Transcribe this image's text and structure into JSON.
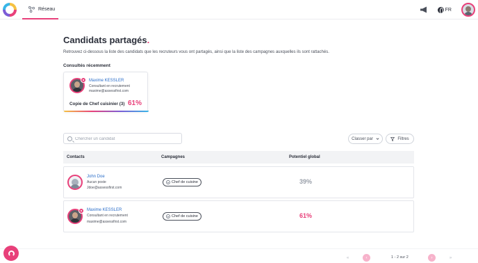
{
  "nav": {
    "tab_label": "Réseau"
  },
  "header": {
    "lang_label": "FR"
  },
  "page": {
    "title": "Candidats partagés",
    "title_dot": ".",
    "description": "Retrouvez ci-dessous la liste des candidats que les recruteurs vous ont partagés, ainsi que la liste des campagnes auxquelles ils sont rattachés."
  },
  "recent": {
    "title": "Consultés récemment",
    "card": {
      "name": "Maxime KESSLER",
      "role": "Consultant en recrutement",
      "email": "maxime@assessfirst.com",
      "campaign": "Copie de Chef cuisinier (3)",
      "score": "61%"
    }
  },
  "search": {
    "placeholder": "Chercher un candidat"
  },
  "sort": {
    "label": "Classer par"
  },
  "filters": {
    "label": "Filtres"
  },
  "table": {
    "headers": {
      "contacts": "Contacts",
      "campaigns": "Campagnes",
      "potential": "Potentiel global"
    },
    "rows": [
      {
        "name": "John Doe",
        "role": "Aucun poste",
        "email": "Jdoe@assessfirst.com",
        "campaign": "Chef de cuisine",
        "potential": "39%",
        "potential_color": "#9aa0aa"
      },
      {
        "name": "Maxime KESSLER",
        "role": "Consultant en recrutement",
        "email": "maxime@assessfirst.com",
        "campaign": "Chef de cuisine",
        "potential": "61%",
        "potential_color": "#e8407a"
      }
    ]
  },
  "pagination": {
    "text": "1 - 2 sur 2"
  },
  "colors": {
    "accent": "#e8407a",
    "link": "#2b6ec9",
    "muted": "#9aa0aa"
  }
}
